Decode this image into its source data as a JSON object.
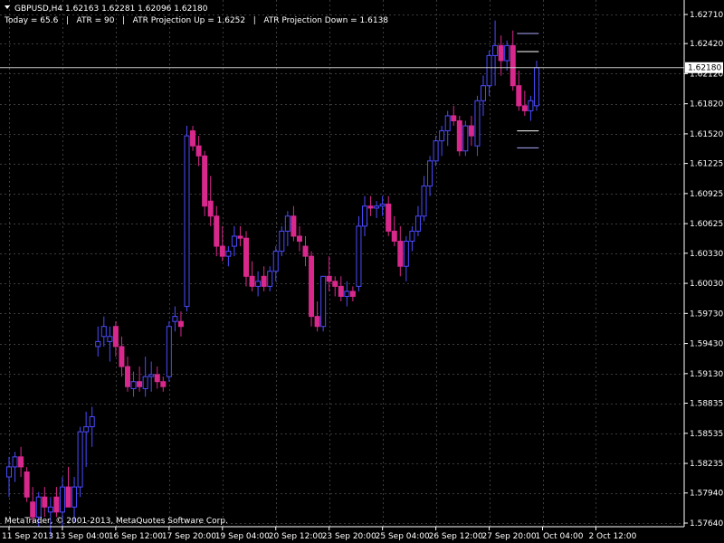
{
  "window": {
    "symbol_line": "GBPUSD,H4  1.62163 1.62281 1.62096 1.62180",
    "indicators_line": "Today = 65.6   |   ATR = 90   |   ATR Projection Up = 1.6252   |   ATR Projection Down = 1.6138",
    "copyright": "MetaTrader, © 2001-2013, MetaQuotes Software Corp."
  },
  "colors": {
    "background": "#000000",
    "grid": "#3c3c3c",
    "axis_text": "#ffffff",
    "bull": "#4b4bff",
    "bear": "#d8288c",
    "wick": "#aaaaaa",
    "price_line": "#c8c8c8",
    "projection": "#aaaaff",
    "price_label_bg": "#ffffff",
    "price_label_text": "#000000"
  },
  "chart_data": {
    "type": "candlestick",
    "symbol": "GBPUSD",
    "timeframe": "H4",
    "last_bar": {
      "open": 1.62163,
      "high": 1.62281,
      "low": 1.62096,
      "close": 1.6218
    },
    "current_price_label": "1.62180",
    "ylim": [
      1.5762,
      1.6285
    ],
    "y_ticks": [
      "1.62710",
      "1.62420",
      "1.62120",
      "1.61820",
      "1.61520",
      "1.61225",
      "1.60925",
      "1.60625",
      "1.60330",
      "1.60030",
      "1.59730",
      "1.59430",
      "1.59130",
      "1.58835",
      "1.58535",
      "1.58235",
      "1.57940",
      "1.57640"
    ],
    "x_labels": [
      {
        "bar": 0,
        "label": "11 Sep 2013"
      },
      {
        "bar": 9,
        "label": "13 Sep 04:00"
      },
      {
        "bar": 18,
        "label": "16 Sep 12:00"
      },
      {
        "bar": 27,
        "label": "17 Sep 20:00"
      },
      {
        "bar": 36,
        "label": "19 Sep 04:00"
      },
      {
        "bar": 45,
        "label": "20 Sep 12:00"
      },
      {
        "bar": 54,
        "label": "23 Sep 20:00"
      },
      {
        "bar": 63,
        "label": "25 Sep 04:00"
      },
      {
        "bar": 72,
        "label": "26 Sep 12:00"
      },
      {
        "bar": 81,
        "label": "27 Sep 20:00"
      },
      {
        "bar": 90,
        "label": "1 Oct 04:00"
      },
      {
        "bar": 99,
        "label": "2 Oct 12:00"
      }
    ],
    "atr_projection_up": 1.6252,
    "atr_projection_down": 1.6138,
    "atr_extra_levels": [
      1.6234,
      1.6155
    ],
    "candles": [
      [
        1.581,
        1.583,
        1.579,
        1.582
      ],
      [
        1.582,
        1.5835,
        1.5805,
        1.583
      ],
      [
        1.583,
        1.584,
        1.581,
        1.582
      ],
      [
        1.5815,
        1.582,
        1.5785,
        1.579
      ],
      [
        1.5785,
        1.58,
        1.5765,
        1.577
      ],
      [
        1.577,
        1.5795,
        1.576,
        1.579
      ],
      [
        1.579,
        1.58,
        1.577,
        1.578
      ],
      [
        1.5775,
        1.579,
        1.575,
        1.578
      ],
      [
        1.579,
        1.58,
        1.577,
        1.5775
      ],
      [
        1.5775,
        1.581,
        1.576,
        1.58
      ],
      [
        1.58,
        1.582,
        1.578,
        1.578
      ],
      [
        1.578,
        1.581,
        1.5765,
        1.58
      ],
      [
        1.58,
        1.586,
        1.579,
        1.5855
      ],
      [
        1.5855,
        1.5875,
        1.582,
        1.586
      ],
      [
        1.586,
        1.588,
        1.584,
        1.587
      ],
      [
        1.594,
        1.596,
        1.593,
        1.5945
      ],
      [
        1.595,
        1.597,
        1.594,
        1.596
      ],
      [
        1.5945,
        1.596,
        1.5925,
        1.595
      ],
      [
        1.596,
        1.5965,
        1.593,
        1.594
      ],
      [
        1.594,
        1.595,
        1.591,
        1.592
      ],
      [
        1.592,
        1.593,
        1.5895,
        1.59
      ],
      [
        1.5898,
        1.5915,
        1.589,
        1.5905
      ],
      [
        1.5905,
        1.592,
        1.5895,
        1.59
      ],
      [
        1.5898,
        1.593,
        1.589,
        1.591
      ],
      [
        1.591,
        1.5925,
        1.5895,
        1.5912
      ],
      [
        1.5912,
        1.592,
        1.5898,
        1.5905
      ],
      [
        1.5905,
        1.591,
        1.5895,
        1.59
      ],
      [
        1.591,
        1.5965,
        1.5905,
        1.596
      ],
      [
        1.5965,
        1.598,
        1.5955,
        1.597
      ],
      [
        1.5965,
        1.5975,
        1.595,
        1.596
      ],
      [
        1.598,
        1.616,
        1.5975,
        1.615
      ],
      [
        1.6155,
        1.616,
        1.6135,
        1.614
      ],
      [
        1.614,
        1.615,
        1.612,
        1.613
      ],
      [
        1.613,
        1.6135,
        1.607,
        1.608
      ],
      [
        1.6085,
        1.611,
        1.606,
        1.607
      ],
      [
        1.607,
        1.608,
        1.603,
        1.604
      ],
      [
        1.604,
        1.606,
        1.6025,
        1.603
      ],
      [
        1.603,
        1.604,
        1.602,
        1.6035
      ],
      [
        1.604,
        1.606,
        1.603,
        1.605
      ],
      [
        1.605,
        1.606,
        1.604,
        1.6048
      ],
      [
        1.6048,
        1.6055,
        1.6,
        1.601
      ],
      [
        1.601,
        1.6025,
        1.5995,
        1.6
      ],
      [
        1.6,
        1.6015,
        1.599,
        1.6005
      ],
      [
        1.601,
        1.602,
        1.5995,
        1.6
      ],
      [
        1.6,
        1.602,
        1.5995,
        1.6015
      ],
      [
        1.6015,
        1.604,
        1.6005,
        1.6035
      ],
      [
        1.6035,
        1.606,
        1.603,
        1.6055
      ],
      [
        1.6055,
        1.6075,
        1.604,
        1.607
      ],
      [
        1.607,
        1.608,
        1.6045,
        1.605
      ],
      [
        1.605,
        1.606,
        1.6035,
        1.6045
      ],
      [
        1.604,
        1.605,
        1.602,
        1.603
      ],
      [
        1.603,
        1.6035,
        1.596,
        1.597
      ],
      [
        1.597,
        1.5985,
        1.5955,
        1.596
      ],
      [
        1.596,
        1.598,
        1.5955,
        1.601
      ],
      [
        1.601,
        1.603,
        1.5995,
        1.6005
      ],
      [
        1.6005,
        1.601,
        1.599,
        1.6
      ],
      [
        1.6,
        1.601,
        1.5985,
        1.599
      ],
      [
        1.599,
        1.6005,
        1.598,
        1.5995
      ],
      [
        1.5995,
        1.6,
        1.5985,
        1.599
      ],
      [
        1.6,
        1.607,
        1.5995,
        1.606
      ],
      [
        1.606,
        1.609,
        1.605,
        1.608
      ],
      [
        1.608,
        1.609,
        1.607,
        1.6078
      ],
      [
        1.6078,
        1.6085,
        1.6068,
        1.608
      ],
      [
        1.608,
        1.609,
        1.607,
        1.6082
      ],
      [
        1.6082,
        1.609,
        1.605,
        1.6055
      ],
      [
        1.6055,
        1.607,
        1.604,
        1.6045
      ],
      [
        1.6045,
        1.606,
        1.601,
        1.602
      ],
      [
        1.602,
        1.605,
        1.6005,
        1.6045
      ],
      [
        1.6045,
        1.606,
        1.6035,
        1.6055
      ],
      [
        1.6055,
        1.608,
        1.605,
        1.607
      ],
      [
        1.607,
        1.611,
        1.6065,
        1.61
      ],
      [
        1.61,
        1.613,
        1.609,
        1.6125
      ],
      [
        1.6125,
        1.615,
        1.612,
        1.6145
      ],
      [
        1.6145,
        1.616,
        1.613,
        1.6155
      ],
      [
        1.6155,
        1.6175,
        1.614,
        1.617
      ],
      [
        1.617,
        1.618,
        1.616,
        1.6165
      ],
      [
        1.6165,
        1.617,
        1.613,
        1.6135
      ],
      [
        1.6135,
        1.6165,
        1.613,
        1.616
      ],
      [
        1.616,
        1.617,
        1.614,
        1.615
      ],
      [
        1.614,
        1.619,
        1.613,
        1.6185
      ],
      [
        1.6185,
        1.621,
        1.617,
        1.62
      ],
      [
        1.62,
        1.6235,
        1.619,
        1.623
      ],
      [
        1.623,
        1.6265,
        1.62,
        1.624
      ],
      [
        1.624,
        1.625,
        1.621,
        1.6225
      ],
      [
        1.6225,
        1.6245,
        1.6215,
        1.624
      ],
      [
        1.624,
        1.6255,
        1.6195,
        1.62
      ],
      [
        1.62,
        1.6215,
        1.6175,
        1.618
      ],
      [
        1.618,
        1.6195,
        1.617,
        1.6175
      ],
      [
        1.6175,
        1.619,
        1.6165,
        1.6185
      ],
      [
        1.618,
        1.6225,
        1.6175,
        1.6218
      ]
    ]
  }
}
